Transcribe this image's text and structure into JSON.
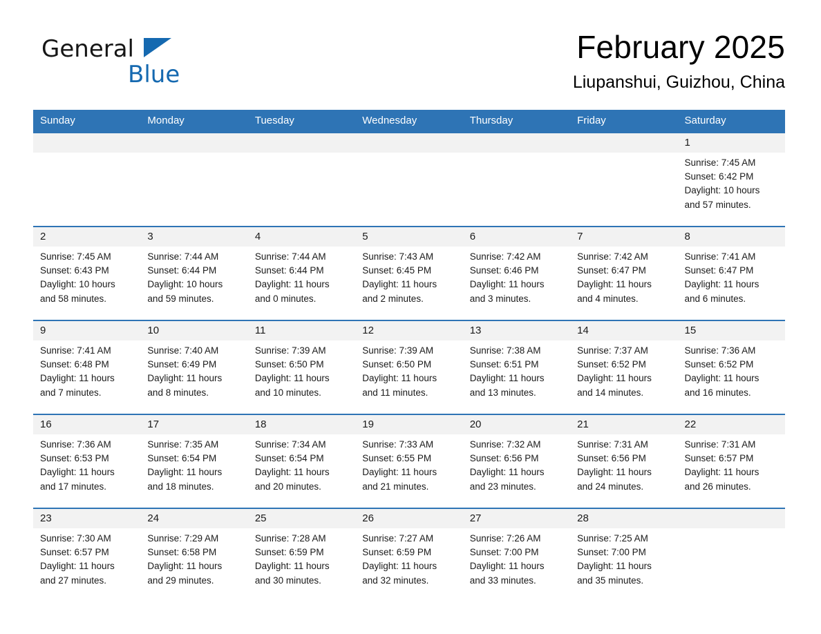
{
  "brand": {
    "name_part1": "General",
    "name_part2": "Blue",
    "triangle_color": "#1569b0",
    "text_color": "#161616"
  },
  "header": {
    "title": "February 2025",
    "subtitle": "Liupanshui, Guizhou, China"
  },
  "theme": {
    "header_bg": "#2e74b5",
    "header_text": "#ffffff",
    "daynum_bg": "#f2f2f2",
    "row_divider": "#2e74b5",
    "cell_bg": "#ffffff"
  },
  "weekday_headers": [
    "Sunday",
    "Monday",
    "Tuesday",
    "Wednesday",
    "Thursday",
    "Friday",
    "Saturday"
  ],
  "weeks": [
    [
      {
        "day": "",
        "lines": []
      },
      {
        "day": "",
        "lines": []
      },
      {
        "day": "",
        "lines": []
      },
      {
        "day": "",
        "lines": []
      },
      {
        "day": "",
        "lines": []
      },
      {
        "day": "",
        "lines": []
      },
      {
        "day": "1",
        "lines": [
          "Sunrise: 7:45 AM",
          "Sunset: 6:42 PM",
          "Daylight: 10 hours",
          "and 57 minutes."
        ]
      }
    ],
    [
      {
        "day": "2",
        "lines": [
          "Sunrise: 7:45 AM",
          "Sunset: 6:43 PM",
          "Daylight: 10 hours",
          "and 58 minutes."
        ]
      },
      {
        "day": "3",
        "lines": [
          "Sunrise: 7:44 AM",
          "Sunset: 6:44 PM",
          "Daylight: 10 hours",
          "and 59 minutes."
        ]
      },
      {
        "day": "4",
        "lines": [
          "Sunrise: 7:44 AM",
          "Sunset: 6:44 PM",
          "Daylight: 11 hours",
          "and 0 minutes."
        ]
      },
      {
        "day": "5",
        "lines": [
          "Sunrise: 7:43 AM",
          "Sunset: 6:45 PM",
          "Daylight: 11 hours",
          "and 2 minutes."
        ]
      },
      {
        "day": "6",
        "lines": [
          "Sunrise: 7:42 AM",
          "Sunset: 6:46 PM",
          "Daylight: 11 hours",
          "and 3 minutes."
        ]
      },
      {
        "day": "7",
        "lines": [
          "Sunrise: 7:42 AM",
          "Sunset: 6:47 PM",
          "Daylight: 11 hours",
          "and 4 minutes."
        ]
      },
      {
        "day": "8",
        "lines": [
          "Sunrise: 7:41 AM",
          "Sunset: 6:47 PM",
          "Daylight: 11 hours",
          "and 6 minutes."
        ]
      }
    ],
    [
      {
        "day": "9",
        "lines": [
          "Sunrise: 7:41 AM",
          "Sunset: 6:48 PM",
          "Daylight: 11 hours",
          "and 7 minutes."
        ]
      },
      {
        "day": "10",
        "lines": [
          "Sunrise: 7:40 AM",
          "Sunset: 6:49 PM",
          "Daylight: 11 hours",
          "and 8 minutes."
        ]
      },
      {
        "day": "11",
        "lines": [
          "Sunrise: 7:39 AM",
          "Sunset: 6:50 PM",
          "Daylight: 11 hours",
          "and 10 minutes."
        ]
      },
      {
        "day": "12",
        "lines": [
          "Sunrise: 7:39 AM",
          "Sunset: 6:50 PM",
          "Daylight: 11 hours",
          "and 11 minutes."
        ]
      },
      {
        "day": "13",
        "lines": [
          "Sunrise: 7:38 AM",
          "Sunset: 6:51 PM",
          "Daylight: 11 hours",
          "and 13 minutes."
        ]
      },
      {
        "day": "14",
        "lines": [
          "Sunrise: 7:37 AM",
          "Sunset: 6:52 PM",
          "Daylight: 11 hours",
          "and 14 minutes."
        ]
      },
      {
        "day": "15",
        "lines": [
          "Sunrise: 7:36 AM",
          "Sunset: 6:52 PM",
          "Daylight: 11 hours",
          "and 16 minutes."
        ]
      }
    ],
    [
      {
        "day": "16",
        "lines": [
          "Sunrise: 7:36 AM",
          "Sunset: 6:53 PM",
          "Daylight: 11 hours",
          "and 17 minutes."
        ]
      },
      {
        "day": "17",
        "lines": [
          "Sunrise: 7:35 AM",
          "Sunset: 6:54 PM",
          "Daylight: 11 hours",
          "and 18 minutes."
        ]
      },
      {
        "day": "18",
        "lines": [
          "Sunrise: 7:34 AM",
          "Sunset: 6:54 PM",
          "Daylight: 11 hours",
          "and 20 minutes."
        ]
      },
      {
        "day": "19",
        "lines": [
          "Sunrise: 7:33 AM",
          "Sunset: 6:55 PM",
          "Daylight: 11 hours",
          "and 21 minutes."
        ]
      },
      {
        "day": "20",
        "lines": [
          "Sunrise: 7:32 AM",
          "Sunset: 6:56 PM",
          "Daylight: 11 hours",
          "and 23 minutes."
        ]
      },
      {
        "day": "21",
        "lines": [
          "Sunrise: 7:31 AM",
          "Sunset: 6:56 PM",
          "Daylight: 11 hours",
          "and 24 minutes."
        ]
      },
      {
        "day": "22",
        "lines": [
          "Sunrise: 7:31 AM",
          "Sunset: 6:57 PM",
          "Daylight: 11 hours",
          "and 26 minutes."
        ]
      }
    ],
    [
      {
        "day": "23",
        "lines": [
          "Sunrise: 7:30 AM",
          "Sunset: 6:57 PM",
          "Daylight: 11 hours",
          "and 27 minutes."
        ]
      },
      {
        "day": "24",
        "lines": [
          "Sunrise: 7:29 AM",
          "Sunset: 6:58 PM",
          "Daylight: 11 hours",
          "and 29 minutes."
        ]
      },
      {
        "day": "25",
        "lines": [
          "Sunrise: 7:28 AM",
          "Sunset: 6:59 PM",
          "Daylight: 11 hours",
          "and 30 minutes."
        ]
      },
      {
        "day": "26",
        "lines": [
          "Sunrise: 7:27 AM",
          "Sunset: 6:59 PM",
          "Daylight: 11 hours",
          "and 32 minutes."
        ]
      },
      {
        "day": "27",
        "lines": [
          "Sunrise: 7:26 AM",
          "Sunset: 7:00 PM",
          "Daylight: 11 hours",
          "and 33 minutes."
        ]
      },
      {
        "day": "28",
        "lines": [
          "Sunrise: 7:25 AM",
          "Sunset: 7:00 PM",
          "Daylight: 11 hours",
          "and 35 minutes."
        ]
      },
      {
        "day": "",
        "lines": []
      }
    ]
  ]
}
